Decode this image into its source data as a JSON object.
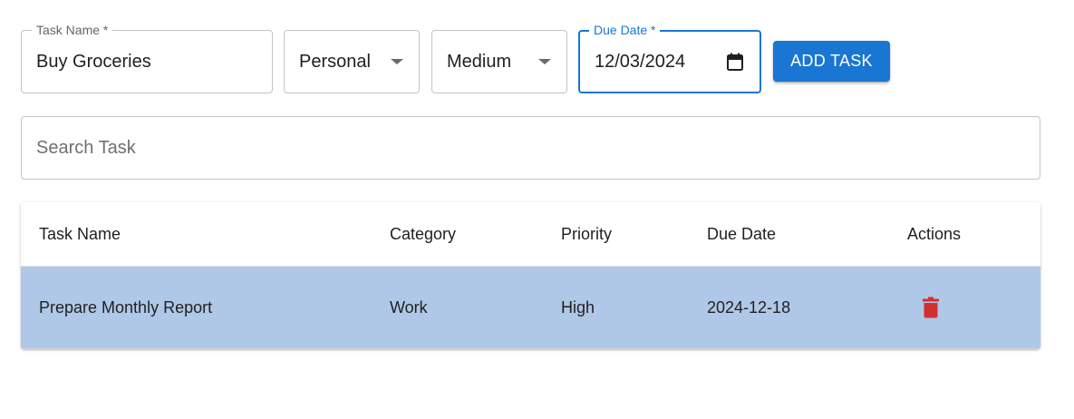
{
  "form": {
    "task_name": {
      "label": "Task Name *",
      "value": "Buy Groceries"
    },
    "category": {
      "value": "Personal"
    },
    "priority": {
      "value": "Medium"
    },
    "due_date": {
      "label": "Due Date *",
      "value": "12/03/2024",
      "icon": "calendar-icon"
    },
    "add_button_label": "ADD TASK"
  },
  "search": {
    "placeholder": "Search Task",
    "value": ""
  },
  "table": {
    "headers": [
      "Task Name",
      "Category",
      "Priority",
      "Due Date",
      "Actions"
    ],
    "rows": [
      {
        "name": "Prepare Monthly Report",
        "category": "Work",
        "priority": "High",
        "due": "2024-12-18",
        "action_icon": "trash-icon"
      }
    ]
  },
  "colors": {
    "accent": "#1976d2",
    "row_highlight": "#b0c8e7",
    "delete": "#d32f2f"
  }
}
